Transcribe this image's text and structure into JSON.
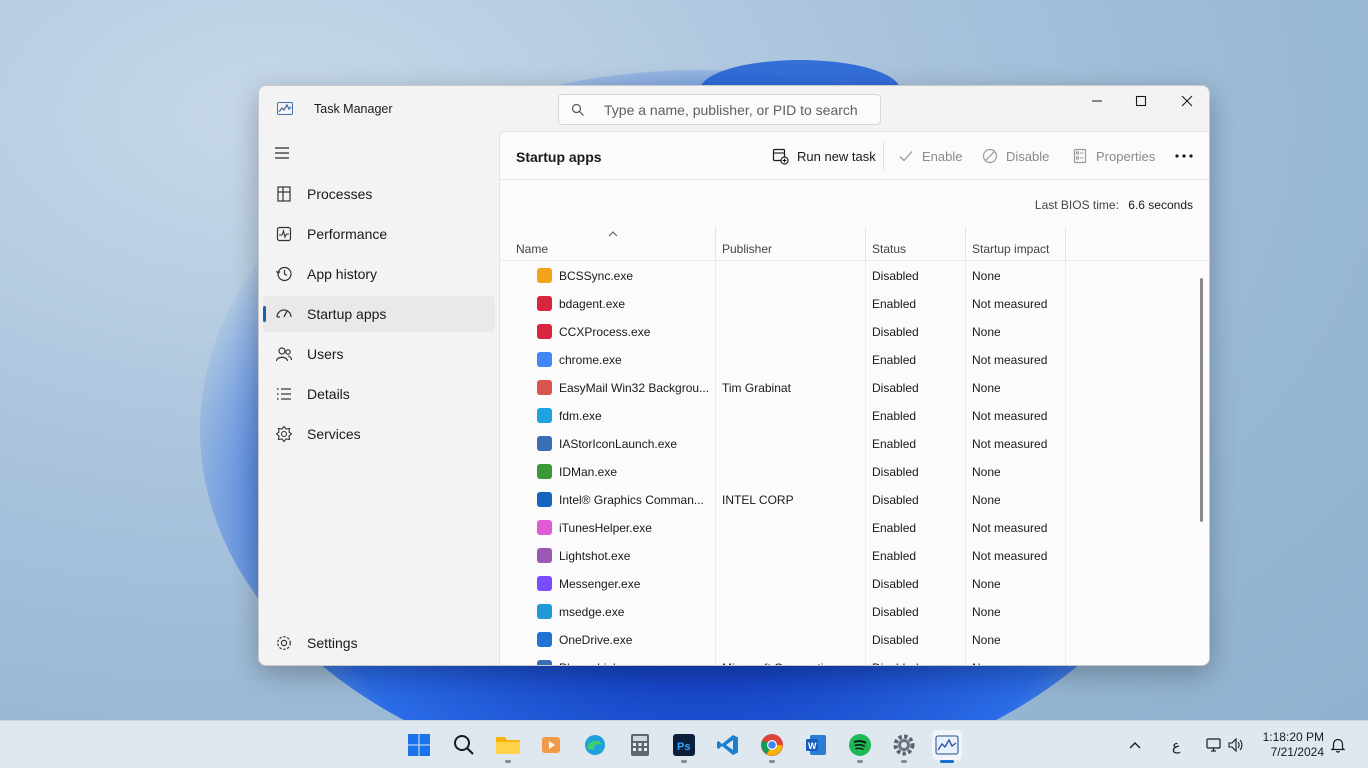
{
  "window": {
    "title": "Task Manager",
    "search_placeholder": "Type a name, publisher, or PID to search"
  },
  "sidebar": {
    "items": [
      {
        "label": "Processes",
        "icon": "processes-icon"
      },
      {
        "label": "Performance",
        "icon": "performance-icon"
      },
      {
        "label": "App history",
        "icon": "app-history-icon"
      },
      {
        "label": "Startup apps",
        "icon": "startup-apps-icon",
        "active": true
      },
      {
        "label": "Users",
        "icon": "users-icon"
      },
      {
        "label": "Details",
        "icon": "details-icon"
      },
      {
        "label": "Services",
        "icon": "services-icon"
      }
    ],
    "settings_label": "Settings"
  },
  "commandbar": {
    "page_title": "Startup apps",
    "run_new_task": "Run new task",
    "enable": "Enable",
    "disable": "Disable",
    "properties": "Properties"
  },
  "bios": {
    "label": "Last BIOS time:",
    "value": "6.6 seconds"
  },
  "table": {
    "columns": [
      "Name",
      "Publisher",
      "Status",
      "Startup impact"
    ],
    "rows": [
      {
        "name": "BCSSync.exe",
        "publisher": "",
        "status": "Disabled",
        "impact": "None",
        "icon_color": "#f2a31a"
      },
      {
        "name": "bdagent.exe",
        "publisher": "",
        "status": "Enabled",
        "impact": "Not measured",
        "icon_color": "#d7263d"
      },
      {
        "name": "CCXProcess.exe",
        "publisher": "",
        "status": "Disabled",
        "impact": "None",
        "icon_color": "#d7263d"
      },
      {
        "name": "chrome.exe",
        "publisher": "",
        "status": "Enabled",
        "impact": "Not measured",
        "icon_color": "#4285f4"
      },
      {
        "name": "EasyMail Win32 Backgrou...",
        "publisher": "Tim Grabinat",
        "status": "Disabled",
        "impact": "None",
        "icon_color": "#d9534f"
      },
      {
        "name": "fdm.exe",
        "publisher": "",
        "status": "Enabled",
        "impact": "Not measured",
        "icon_color": "#1fa3e0"
      },
      {
        "name": "IAStorIconLaunch.exe",
        "publisher": "",
        "status": "Enabled",
        "impact": "Not measured",
        "icon_color": "#3a6fb5"
      },
      {
        "name": "IDMan.exe",
        "publisher": "",
        "status": "Disabled",
        "impact": "None",
        "icon_color": "#3a9a3a"
      },
      {
        "name": "Intel® Graphics Comman...",
        "publisher": "INTEL CORP",
        "status": "Disabled",
        "impact": "None",
        "icon_color": "#1565c0"
      },
      {
        "name": "iTunesHelper.exe",
        "publisher": "",
        "status": "Enabled",
        "impact": "Not measured",
        "icon_color": "#e05ad6"
      },
      {
        "name": "Lightshot.exe",
        "publisher": "",
        "status": "Enabled",
        "impact": "Not measured",
        "icon_color": "#9b59b6"
      },
      {
        "name": "Messenger.exe",
        "publisher": "",
        "status": "Disabled",
        "impact": "None",
        "icon_color": "#7b4dff"
      },
      {
        "name": "msedge.exe",
        "publisher": "",
        "status": "Disabled",
        "impact": "None",
        "icon_color": "#1f9ad6"
      },
      {
        "name": "OneDrive.exe",
        "publisher": "",
        "status": "Disabled",
        "impact": "None",
        "icon_color": "#1e73d4"
      },
      {
        "name": "Phone Link",
        "publisher": "Microsoft Corporation",
        "status": "Disabled",
        "impact": "None",
        "icon_color": "#3a6fb5"
      }
    ]
  },
  "taskbar": {
    "apps": [
      "start-icon",
      "search-icon",
      "file-explorer-icon",
      "media-player-icon",
      "edge-icon",
      "calculator-icon",
      "photoshop-icon",
      "vscode-icon",
      "chrome-icon",
      "word-icon",
      "spotify-icon",
      "settings-icon",
      "task-manager-icon"
    ],
    "ime_char": "ع",
    "time": "1:18:20 PM",
    "date": "7/21/2024"
  },
  "colors": {
    "accent": "#1f5fa8",
    "content_bg": "#fbfbfb",
    "sidebar_bg": "#f3f3f3"
  }
}
